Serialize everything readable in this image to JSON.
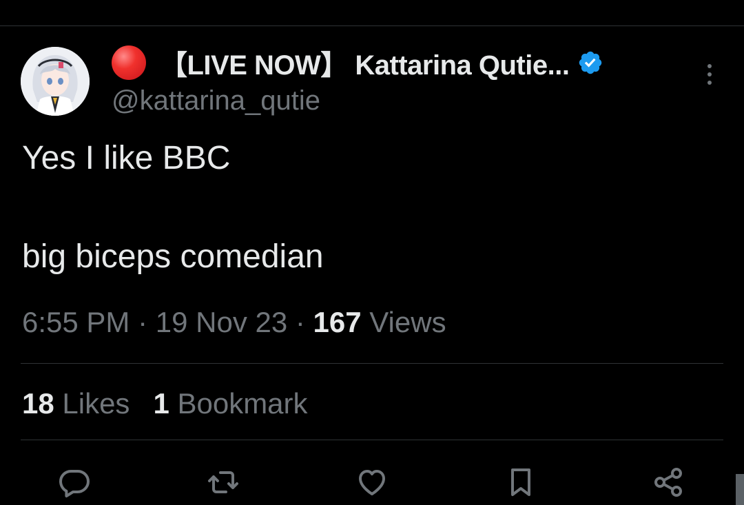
{
  "author": {
    "status_emoji": "red-circle",
    "display_name": "【LIVE NOW】 Kattarina Qutie...",
    "handle": "@kattarina_qutie",
    "verified": true
  },
  "tweet": {
    "line1": "Yes I like BBC",
    "line2": "big biceps comedian"
  },
  "meta": {
    "time": "6:55 PM",
    "sep1": " · ",
    "date": "19 Nov 23",
    "sep2": " · ",
    "views_count": "167",
    "views_label": " Views"
  },
  "stats": {
    "likes_count": "18",
    "likes_label": " Likes",
    "bookmarks_count": "1",
    "bookmarks_label": " Bookmark"
  },
  "actions": [
    {
      "name": "reply",
      "icon": "reply-icon"
    },
    {
      "name": "repost",
      "icon": "repost-icon"
    },
    {
      "name": "like",
      "icon": "heart-icon"
    },
    {
      "name": "bookmark",
      "icon": "bookmark-icon"
    },
    {
      "name": "share",
      "icon": "share-icon"
    }
  ],
  "colors": {
    "background": "#000000",
    "primary_text": "#e7e9ea",
    "secondary_text": "#71767b",
    "divider": "#2f3336",
    "verified_blue": "#1d9bf0",
    "live_red": "#e0232a"
  }
}
